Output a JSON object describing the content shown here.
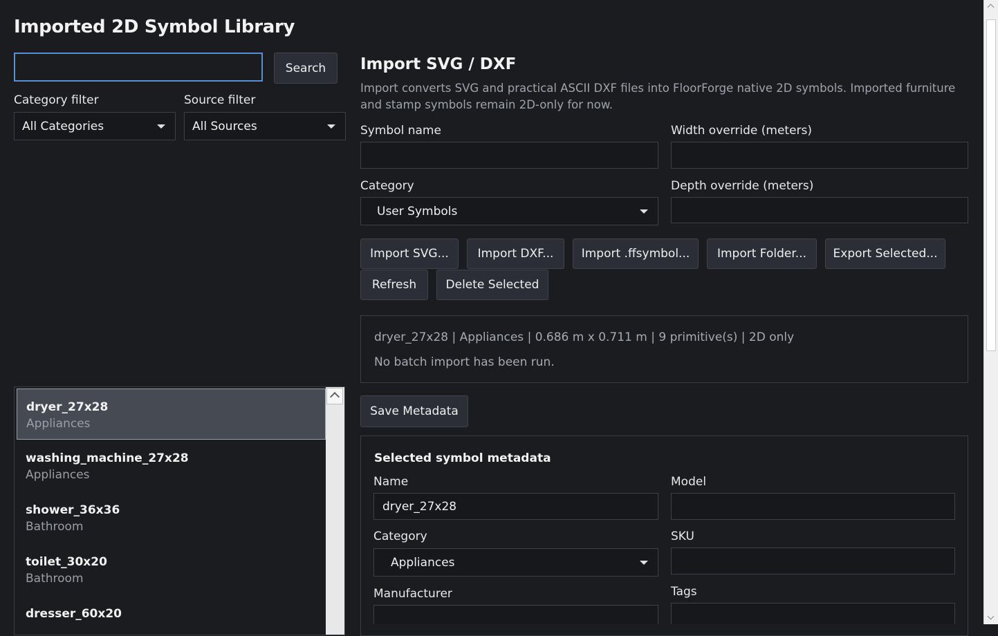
{
  "app": {
    "title": "Imported 2D Symbol Library"
  },
  "search": {
    "value": "",
    "button_label": "Search"
  },
  "filters": {
    "category_label": "Category filter",
    "category_value": "All Categories",
    "source_label": "Source filter",
    "source_value": "All Sources"
  },
  "import": {
    "heading": "Import SVG / DXF",
    "description": "Import converts SVG and practical ASCII DXF files into FloorForge native 2D symbols. Imported furniture and stamp symbols remain 2D-only for now.",
    "symbol_name_label": "Symbol name",
    "symbol_name_value": "",
    "width_label": "Width override (meters)",
    "width_value": "",
    "category_label": "Category",
    "category_value": "User Symbols",
    "depth_label": "Depth override (meters)",
    "depth_value": ""
  },
  "actions": {
    "import_svg": "Import SVG...",
    "import_dxf": "Import DXF...",
    "import_ffsymbol": "Import .ffsymbol...",
    "import_folder": "Import Folder...",
    "export_selected": "Export Selected...",
    "refresh": "Refresh",
    "delete_selected": "Delete Selected"
  },
  "status": {
    "summary": "dryer_27x28 | Appliances | 0.686 m x 0.711 m | 9 primitive(s) | 2D only",
    "batch": "No batch import has been run."
  },
  "save_metadata_label": "Save Metadata",
  "metadata": {
    "title": "Selected symbol metadata",
    "name_label": "Name",
    "name_value": "dryer_27x28",
    "model_label": "Model",
    "model_value": "",
    "category_label": "Category",
    "category_value": "Appliances",
    "sku_label": "SKU",
    "sku_value": "",
    "manufacturer_label": "Manufacturer",
    "tags_label": "Tags"
  },
  "symbols": [
    {
      "name": "dryer_27x28",
      "category": "Appliances",
      "selected": true
    },
    {
      "name": "washing_machine_27x28",
      "category": "Appliances",
      "selected": false
    },
    {
      "name": "shower_36x36",
      "category": "Bathroom",
      "selected": false
    },
    {
      "name": "toilet_30x20",
      "category": "Bathroom",
      "selected": false
    },
    {
      "name": "dresser_60x20",
      "category": "",
      "selected": false
    }
  ],
  "icons": {
    "dropdown": "chevron-down-icon",
    "scroll_up": "chevron-up-icon"
  },
  "colors": {
    "background": "#1b1c20",
    "button": "#2b2e36",
    "selected_row": "#464a52",
    "focus_border": "#5a8fd6"
  }
}
